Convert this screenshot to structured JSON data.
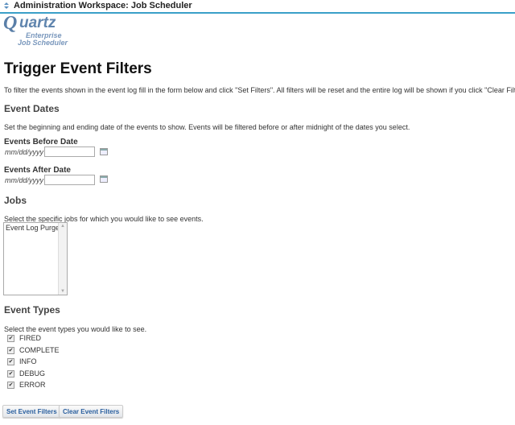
{
  "window": {
    "title": "Administration Workspace: Job Scheduler"
  },
  "logo": {
    "q": "Q",
    "main": "uartz",
    "line1": "Enterprise",
    "line2": "Job Scheduler"
  },
  "page": {
    "title": "Trigger Event Filters",
    "intro": "To filter the events shown in the event log fill in the form below and click \"Set Filters\". All filters will be reset and the entire log will be shown if you click \"Clear Filters\"."
  },
  "event_dates": {
    "heading": "Event Dates",
    "description": "Set the beginning and ending date of the events to show. Events will be filtered before or after midnight of the dates you select.",
    "before": {
      "label": "Events Before Date",
      "format": "mm/dd/yyyy",
      "value": ""
    },
    "after": {
      "label": "Events After Date",
      "format": "mm/dd/yyyy",
      "value": ""
    }
  },
  "jobs": {
    "heading": "Jobs",
    "description": "Select the specific jobs for which you would like to see events.",
    "options": [
      "Event Log Purge"
    ]
  },
  "event_types": {
    "heading": "Event Types",
    "description": "Select the event types you would like to see.",
    "items": [
      {
        "label": "FIRED",
        "checked": true
      },
      {
        "label": "COMPLETE",
        "checked": true
      },
      {
        "label": "INFO",
        "checked": true
      },
      {
        "label": "DEBUG",
        "checked": true
      },
      {
        "label": "ERROR",
        "checked": true
      }
    ]
  },
  "buttons": {
    "set": "Set Event Filters",
    "clear": "Clear Event Filters"
  }
}
